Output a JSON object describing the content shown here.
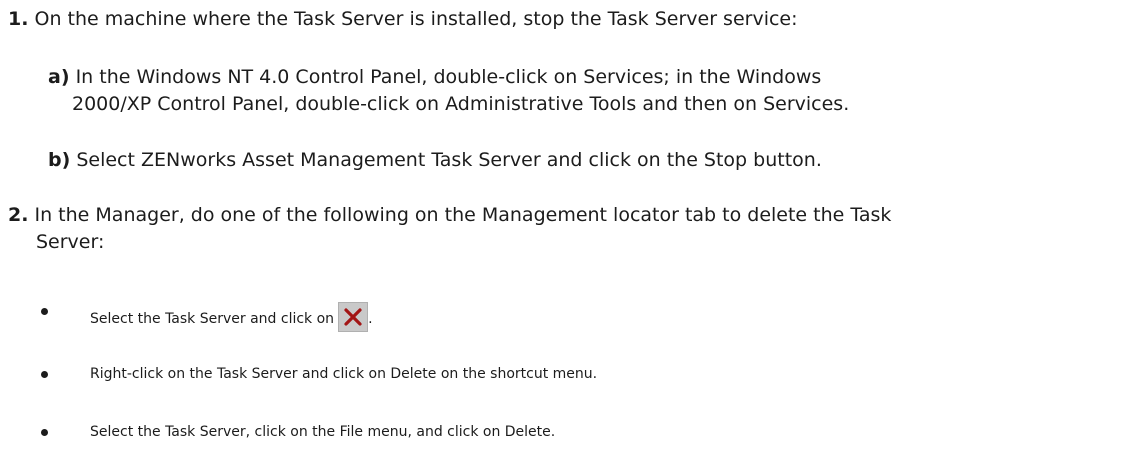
{
  "steps": [
    {
      "number": "1.",
      "text": "On the machine where the Task Server is installed, stop the Task Server service:",
      "substeps": [
        {
          "letter": "a)",
          "line1": "In the Windows NT 4.0 Control Panel, double-click on Services; in the Windows",
          "line2": "2000/XP Control Panel, double-click on Administrative Tools and then on Services."
        },
        {
          "letter": "b)",
          "line1": "Select ZENworks Asset Management Task Server and click on the Stop button."
        }
      ]
    },
    {
      "number": "2.",
      "line1": "In the Manager, do one of the following on the Management locator tab to delete the Task",
      "line2": "Server:",
      "bullets": [
        {
          "text": "Select the Task Server and click on",
          "suffix": ".",
          "icon": "delete-x-icon"
        },
        {
          "text": "Right-click on the Task Server and click on Delete on the shortcut menu."
        },
        {
          "text": "Select the Task Server, click on the File menu, and click on Delete."
        }
      ]
    }
  ],
  "colors": {
    "text": "#1c1c1c",
    "delete_icon": "#a31515",
    "icon_bg": "#c9c9c9"
  }
}
